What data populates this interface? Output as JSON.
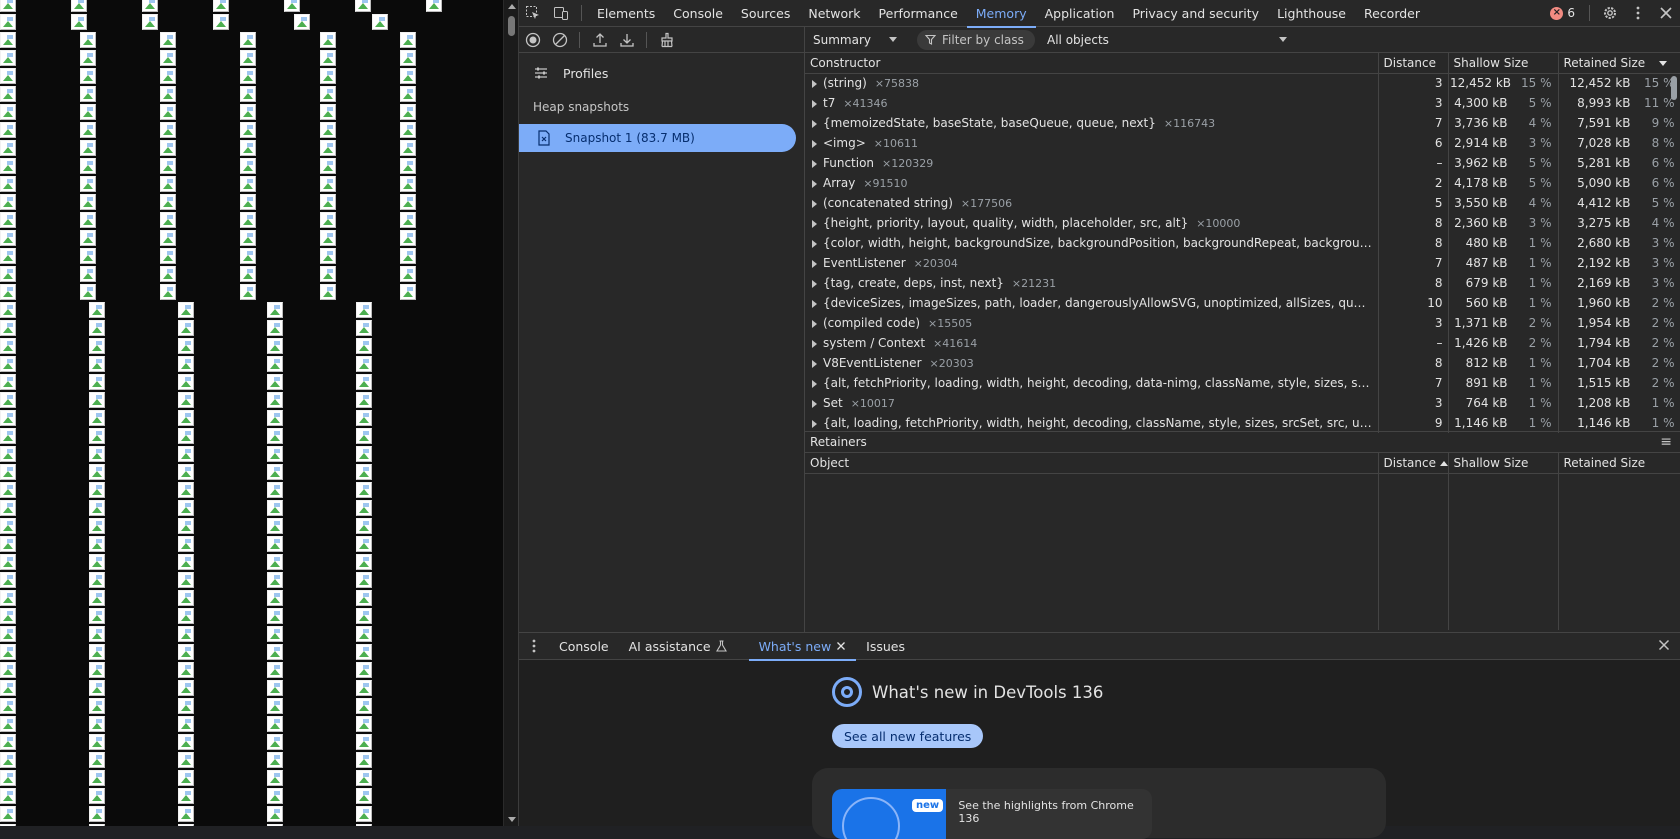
{
  "toolbar": {
    "tabs": [
      "Elements",
      "Console",
      "Sources",
      "Network",
      "Performance",
      "Memory",
      "Application",
      "Privacy and security",
      "Lighthouse",
      "Recorder"
    ],
    "active_tab": "Memory",
    "error_count": "6"
  },
  "memory": {
    "profiles_label": "Profiles",
    "heap_snapshots_label": "Heap snapshots",
    "snapshot_label": "Snapshot 1 (83.7 MB)"
  },
  "filter": {
    "view": "Summary",
    "filter_placeholder": "Filter by class",
    "objects": "All objects"
  },
  "summary_table": {
    "columns": [
      "Constructor",
      "Distance",
      "Shallow Size",
      "Retained Size"
    ],
    "rows": [
      {
        "name": "(string)",
        "count": "×75838",
        "distance": "3",
        "shallow": "12,452 kB",
        "shallow_pct": "15 %",
        "retained": "12,452 kB",
        "retained_pct": "15 %"
      },
      {
        "name": "t7",
        "count": "×41346",
        "distance": "3",
        "shallow": "4,300 kB",
        "shallow_pct": "5 %",
        "retained": "8,993 kB",
        "retained_pct": "11 %"
      },
      {
        "name": "{memoizedState, baseState, baseQueue, queue, next}",
        "count": "×116743",
        "distance": "7",
        "shallow": "3,736 kB",
        "shallow_pct": "4 %",
        "retained": "7,591 kB",
        "retained_pct": "9 %"
      },
      {
        "name": "<img>",
        "count": "×10611",
        "distance": "6",
        "shallow": "2,914 kB",
        "shallow_pct": "3 %",
        "retained": "7,028 kB",
        "retained_pct": "8 %"
      },
      {
        "name": "Function",
        "count": "×120329",
        "distance": "–",
        "shallow": "3,962 kB",
        "shallow_pct": "5 %",
        "retained": "5,281 kB",
        "retained_pct": "6 %"
      },
      {
        "name": "Array",
        "count": "×91510",
        "distance": "2",
        "shallow": "4,178 kB",
        "shallow_pct": "5 %",
        "retained": "5,090 kB",
        "retained_pct": "6 %"
      },
      {
        "name": "(concatenated string)",
        "count": "×177506",
        "distance": "5",
        "shallow": "3,550 kB",
        "shallow_pct": "4 %",
        "retained": "4,412 kB",
        "retained_pct": "5 %"
      },
      {
        "name": "{height, priority, layout, quality, width, placeholder, src, alt}",
        "count": "×10000",
        "distance": "8",
        "shallow": "2,360 kB",
        "shallow_pct": "3 %",
        "retained": "3,275 kB",
        "retained_pct": "4 %"
      },
      {
        "name": "{color, width, height, backgroundSize, backgroundPosition, backgroundRepeat, backgroundImage}…",
        "count": "",
        "distance": "8",
        "shallow": "480 kB",
        "shallow_pct": "1 %",
        "retained": "2,680 kB",
        "retained_pct": "3 %"
      },
      {
        "name": "EventListener",
        "count": "×20304",
        "distance": "7",
        "shallow": "487 kB",
        "shallow_pct": "1 %",
        "retained": "2,192 kB",
        "retained_pct": "3 %"
      },
      {
        "name": "{tag, create, deps, inst, next}",
        "count": "×21231",
        "distance": "8",
        "shallow": "679 kB",
        "shallow_pct": "1 %",
        "retained": "2,169 kB",
        "retained_pct": "3 %"
      },
      {
        "name": "{deviceSizes, imageSizes, path, loader, dangerouslyAllowSVG, unoptimized, allSizes, qualities}",
        "count": "×10000",
        "distance": "10",
        "shallow": "560 kB",
        "shallow_pct": "1 %",
        "retained": "1,960 kB",
        "retained_pct": "2 %"
      },
      {
        "name": "(compiled code)",
        "count": "×15505",
        "distance": "3",
        "shallow": "1,371 kB",
        "shallow_pct": "2 %",
        "retained": "1,954 kB",
        "retained_pct": "2 %"
      },
      {
        "name": "system / Context",
        "count": "×41614",
        "distance": "–",
        "shallow": "1,426 kB",
        "shallow_pct": "2 %",
        "retained": "1,794 kB",
        "retained_pct": "2 %"
      },
      {
        "name": "V8EventListener",
        "count": "×20303",
        "distance": "8",
        "shallow": "812 kB",
        "shallow_pct": "1 %",
        "retained": "1,704 kB",
        "retained_pct": "2 %"
      },
      {
        "name": "{alt, fetchPriority, loading, width, height, decoding, data-nimg, className, style, sizes, srcSet, src, re…",
        "count": "",
        "distance": "7",
        "shallow": "891 kB",
        "shallow_pct": "1 %",
        "retained": "1,515 kB",
        "retained_pct": "2 %"
      },
      {
        "name": "Set",
        "count": "×10017",
        "distance": "3",
        "shallow": "764 kB",
        "shallow_pct": "1 %",
        "retained": "1,208 kB",
        "retained_pct": "1 %"
      },
      {
        "name": "{alt, loading, fetchPriority, width, height, decoding, className, style, sizes, srcSet, src, unoptimized, …",
        "count": "",
        "distance": "9",
        "shallow": "1,146 kB",
        "shallow_pct": "1 %",
        "retained": "1,146 kB",
        "retained_pct": "1 %"
      }
    ]
  },
  "retainers": {
    "title": "Retainers",
    "columns": [
      "Object",
      "Distance",
      "Shallow Size",
      "Retained Size"
    ]
  },
  "drawer": {
    "tabs": [
      "Console",
      "AI assistance",
      "What's new",
      "Issues"
    ],
    "active_tab": "What's new",
    "heading": "What's new in DevTools 136",
    "button": "See all new features",
    "card_badge": "new",
    "card_text": "See the highlights from Chrome 136"
  },
  "colors": {
    "accent": "#7cacf8",
    "error": "#f28b82"
  }
}
